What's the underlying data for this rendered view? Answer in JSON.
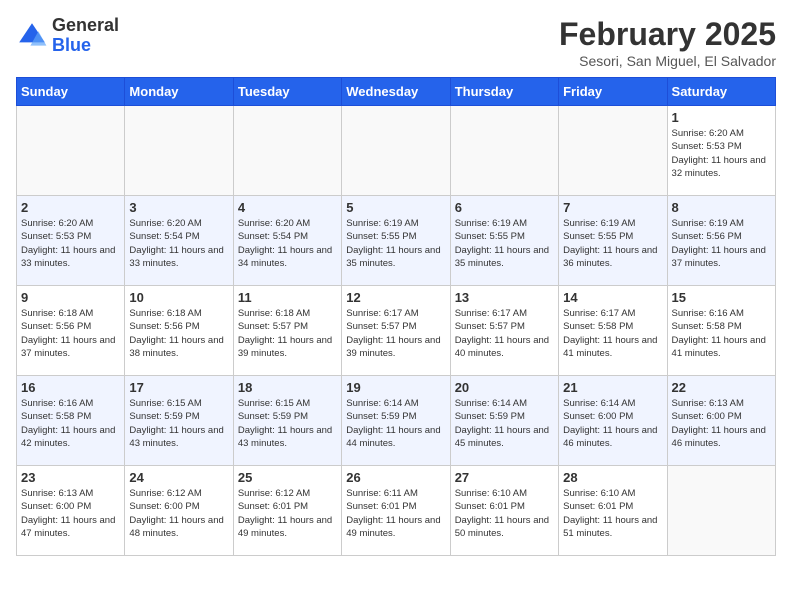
{
  "logo": {
    "general": "General",
    "blue": "Blue"
  },
  "header": {
    "month": "February 2025",
    "location": "Sesori, San Miguel, El Salvador"
  },
  "weekdays": [
    "Sunday",
    "Monday",
    "Tuesday",
    "Wednesday",
    "Thursday",
    "Friday",
    "Saturday"
  ],
  "weeks": [
    [
      {
        "day": "",
        "info": ""
      },
      {
        "day": "",
        "info": ""
      },
      {
        "day": "",
        "info": ""
      },
      {
        "day": "",
        "info": ""
      },
      {
        "day": "",
        "info": ""
      },
      {
        "day": "",
        "info": ""
      },
      {
        "day": "1",
        "info": "Sunrise: 6:20 AM\nSunset: 5:53 PM\nDaylight: 11 hours and 32 minutes."
      }
    ],
    [
      {
        "day": "2",
        "info": "Sunrise: 6:20 AM\nSunset: 5:53 PM\nDaylight: 11 hours and 33 minutes."
      },
      {
        "day": "3",
        "info": "Sunrise: 6:20 AM\nSunset: 5:54 PM\nDaylight: 11 hours and 33 minutes."
      },
      {
        "day": "4",
        "info": "Sunrise: 6:20 AM\nSunset: 5:54 PM\nDaylight: 11 hours and 34 minutes."
      },
      {
        "day": "5",
        "info": "Sunrise: 6:19 AM\nSunset: 5:55 PM\nDaylight: 11 hours and 35 minutes."
      },
      {
        "day": "6",
        "info": "Sunrise: 6:19 AM\nSunset: 5:55 PM\nDaylight: 11 hours and 35 minutes."
      },
      {
        "day": "7",
        "info": "Sunrise: 6:19 AM\nSunset: 5:55 PM\nDaylight: 11 hours and 36 minutes."
      },
      {
        "day": "8",
        "info": "Sunrise: 6:19 AM\nSunset: 5:56 PM\nDaylight: 11 hours and 37 minutes."
      }
    ],
    [
      {
        "day": "9",
        "info": "Sunrise: 6:18 AM\nSunset: 5:56 PM\nDaylight: 11 hours and 37 minutes."
      },
      {
        "day": "10",
        "info": "Sunrise: 6:18 AM\nSunset: 5:56 PM\nDaylight: 11 hours and 38 minutes."
      },
      {
        "day": "11",
        "info": "Sunrise: 6:18 AM\nSunset: 5:57 PM\nDaylight: 11 hours and 39 minutes."
      },
      {
        "day": "12",
        "info": "Sunrise: 6:17 AM\nSunset: 5:57 PM\nDaylight: 11 hours and 39 minutes."
      },
      {
        "day": "13",
        "info": "Sunrise: 6:17 AM\nSunset: 5:57 PM\nDaylight: 11 hours and 40 minutes."
      },
      {
        "day": "14",
        "info": "Sunrise: 6:17 AM\nSunset: 5:58 PM\nDaylight: 11 hours and 41 minutes."
      },
      {
        "day": "15",
        "info": "Sunrise: 6:16 AM\nSunset: 5:58 PM\nDaylight: 11 hours and 41 minutes."
      }
    ],
    [
      {
        "day": "16",
        "info": "Sunrise: 6:16 AM\nSunset: 5:58 PM\nDaylight: 11 hours and 42 minutes."
      },
      {
        "day": "17",
        "info": "Sunrise: 6:15 AM\nSunset: 5:59 PM\nDaylight: 11 hours and 43 minutes."
      },
      {
        "day": "18",
        "info": "Sunrise: 6:15 AM\nSunset: 5:59 PM\nDaylight: 11 hours and 43 minutes."
      },
      {
        "day": "19",
        "info": "Sunrise: 6:14 AM\nSunset: 5:59 PM\nDaylight: 11 hours and 44 minutes."
      },
      {
        "day": "20",
        "info": "Sunrise: 6:14 AM\nSunset: 5:59 PM\nDaylight: 11 hours and 45 minutes."
      },
      {
        "day": "21",
        "info": "Sunrise: 6:14 AM\nSunset: 6:00 PM\nDaylight: 11 hours and 46 minutes."
      },
      {
        "day": "22",
        "info": "Sunrise: 6:13 AM\nSunset: 6:00 PM\nDaylight: 11 hours and 46 minutes."
      }
    ],
    [
      {
        "day": "23",
        "info": "Sunrise: 6:13 AM\nSunset: 6:00 PM\nDaylight: 11 hours and 47 minutes."
      },
      {
        "day": "24",
        "info": "Sunrise: 6:12 AM\nSunset: 6:00 PM\nDaylight: 11 hours and 48 minutes."
      },
      {
        "day": "25",
        "info": "Sunrise: 6:12 AM\nSunset: 6:01 PM\nDaylight: 11 hours and 49 minutes."
      },
      {
        "day": "26",
        "info": "Sunrise: 6:11 AM\nSunset: 6:01 PM\nDaylight: 11 hours and 49 minutes."
      },
      {
        "day": "27",
        "info": "Sunrise: 6:10 AM\nSunset: 6:01 PM\nDaylight: 11 hours and 50 minutes."
      },
      {
        "day": "28",
        "info": "Sunrise: 6:10 AM\nSunset: 6:01 PM\nDaylight: 11 hours and 51 minutes."
      },
      {
        "day": "",
        "info": ""
      }
    ]
  ]
}
